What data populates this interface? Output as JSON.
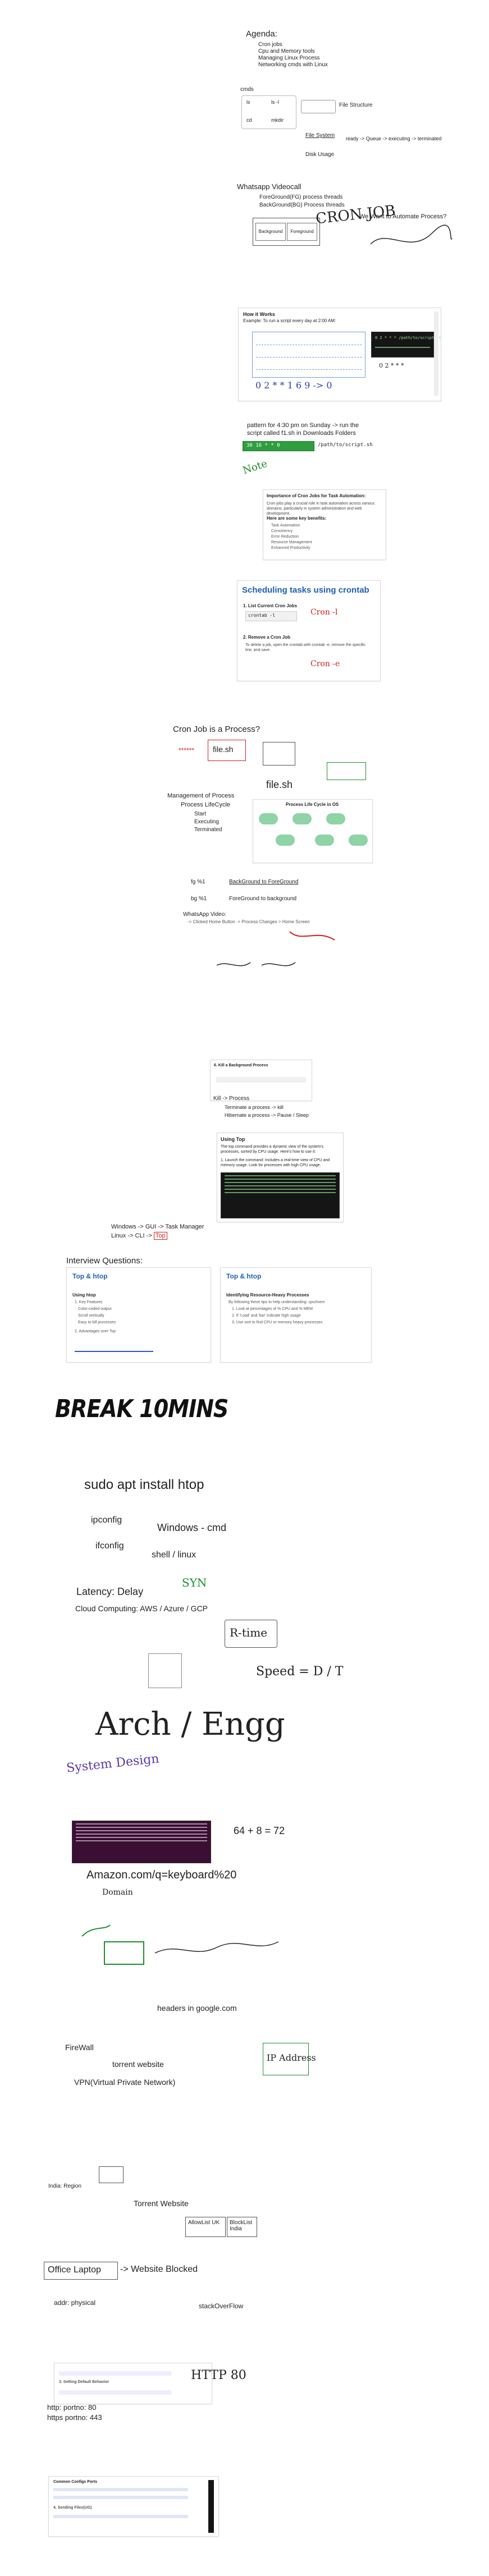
{
  "agenda": {
    "title": "Agenda:",
    "items": [
      "Cron jobs",
      "Cpu and Memory tools",
      "Managing Linux Process",
      "Networking cmds with Linux"
    ]
  },
  "cmds_notes": {
    "cmds": "cmds",
    "ls": "ls",
    "ls_l": "ls -l",
    "cd": "cd",
    "mkdir": "mkdir",
    "file_structure": "File Structure",
    "file_system": "File System",
    "disk_usage": "Disk Usage",
    "process_flow": "ready -> Queue -> executing -> terminated"
  },
  "whatsapp": {
    "title": "Whatsapp Videocall",
    "fg": "ForeGround(FG) process threads",
    "bg": "BackGround(BG) Process threads",
    "box_bg": "Background",
    "box_fg": "Foreground",
    "automate": "We Want to Automate Process?",
    "cron": "CRON JOB"
  },
  "cron_slide": {
    "title": "How it Works",
    "subtitle": "Example: To run a script every day at 2:00 AM:",
    "cmd": "0 2 * * * /path/to/script.sh",
    "note": "0 2 * * *",
    "handwrite": "0 2 * * 1 6 9 -> 0"
  },
  "pattern": {
    "line1": "pattern for 4:30 pm on Sunday -> run the",
    "line2": "script called f1.sh in Downloads Folders",
    "cmd": "30 16 * * 0",
    "cmd_path": "/path/to/script.sh"
  },
  "importance": {
    "hand": "Note",
    "title": "Importance of Cron Jobs for Task Automation:",
    "para": "Cron jobs play a crucial role in task automation across various domains, particularly in system administration and web development.",
    "benefits_title": "Here are some key benefits:",
    "benefits": [
      "Task Automation",
      "Consistency",
      "Error Reduction",
      "Resource Management",
      "Enhanced Productivity"
    ]
  },
  "scheduling": {
    "title": "Scheduling tasks using crontab",
    "l1": "1. List Current Cron Jobs",
    "cmd1": "crontab -l",
    "l2": "2. Remove a Cron Job",
    "l2_desc": "To delete a job, open the crontab with crontab -e, remove the specific line, and save.",
    "hand1": "Cron -l",
    "hand2": "Cron -e"
  },
  "process": {
    "question": "Cron Job is a Process?",
    "stars": "******",
    "file": "file.sh",
    "file2": "file.sh",
    "mgmt": "Management of Process",
    "lifecycle": "Process LifeCycle",
    "stages": [
      "Start",
      "Executing",
      "Terminated"
    ],
    "diagram_title": "Process Life Cycle in OS",
    "fg1": "fg %1",
    "fg1_desc": "BackGround to ForeGround",
    "bg1": "bg %1",
    "bg1_desc": "ForeGround to background",
    "whatsapp": "WhatsApp Video:",
    "whatsapp_desc": "-> Clicked Home Button -> Process Changes > Home Screen"
  },
  "jobs": {
    "kill_title": "Kill -> Process",
    "kill_slide": "6. Kill a Background Process",
    "k1": "Terminate a process -> kill",
    "k2": "Hibernate a process -> Pause / Sleep",
    "top_title": "Using Top",
    "top_desc": "The top command provides a dynamic view of the system's processes, sorted by CPU usage. Here's how to use it:",
    "top_l1": "1. Launch the command: Includes a real-time view of CPU and memory usage. Look for processes with high CPU usage.",
    "win": "Windows -> GUI -> Task Manager",
    "linux_pre": "Linux -> CLI ->",
    "linux_top": "Top"
  },
  "interview": {
    "title": "Interview Questions:",
    "card1_title": "Top & htop",
    "card1_h": "Using htop",
    "card1_items": [
      "1. Key Features",
      "Color-coded output",
      "Scroll vertically",
      "Easy to kill processes",
      "2. Advantages over Top"
    ],
    "card2_title": "Top & htop",
    "card2_h": "Identifying Resource-Heavy Processes",
    "card2_items": [
      "By following these tips to help understanding: cpu/mem",
      "1. Look at percentages of % CPU and % MEM",
      "2. If 'Load' and 'bar' indicate high usage",
      "3. Use sort to find CPU or memory heavy processes"
    ]
  },
  "break_text": "BREAK 10MINS",
  "network": {
    "htop": "sudo apt install htop",
    "ipconfig": "ipconfig",
    "ifconfig": "ifconfig",
    "windows": "Windows - cmd",
    "shell": "shell / linux",
    "latency": "Latency: Delay",
    "syn": "SYN",
    "cloud": "Cloud Computing: AWS / Azure / GCP",
    "rtime": "R-time",
    "speed": "Speed = D / T",
    "arch": "Arch / Engg",
    "sysdesign": "System Design",
    "calc": "64 + 8 = 72",
    "amazon": "Amazon.com/q=keyboard%20",
    "domain": "Domain",
    "headers": "headers in google.com",
    "firewall": "FireWall",
    "torrent": "torrent website",
    "vpn": "VPN(Virtual Private Network)",
    "ipaddr": "IP Address",
    "india": "India: Region",
    "torrent_site": "Torrent Website",
    "allowlist": "AllowList UK",
    "blocklist": "BlockList India",
    "office": "Office Laptop",
    "blocked": "-> Website Blocked",
    "addr": "addr: physical",
    "stack": "stackOverFlow",
    "http": "http: portno: 80",
    "https": "https portno: 443",
    "http_hand": "HTTP 80",
    "ports_title": "Common Configs Ports",
    "ports_slide": "3. Setting Default Behavior",
    "ports_slide2": "4. Sending Files(UG)"
  },
  "colors": {
    "accent_blue": "#1f5fb3",
    "ink_red": "#d21f1f",
    "ink_green": "#1d8f2a",
    "ink_purple": "#5a3aa8"
  }
}
